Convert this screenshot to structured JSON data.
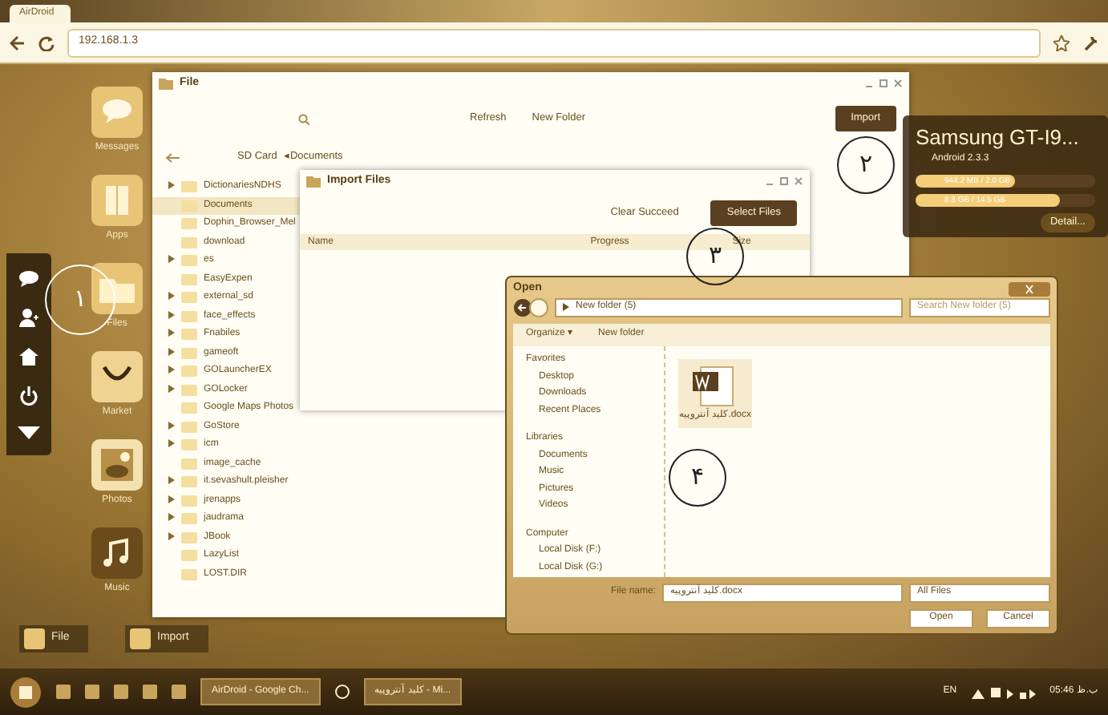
{
  "browser": {
    "tab_title": "AirDroid",
    "address": "192.168.1.3"
  },
  "desktop_icons": [
    {
      "label": "Messages",
      "kind": "messages"
    },
    {
      "label": "Apps",
      "kind": "apps"
    },
    {
      "label": "Files",
      "kind": "files"
    },
    {
      "label": "Market",
      "kind": "market"
    },
    {
      "label": "Photos",
      "kind": "photos"
    },
    {
      "label": "Music",
      "kind": "music"
    }
  ],
  "file_window": {
    "title": "File",
    "buttons": [
      "Refresh",
      "New Folder"
    ],
    "import_button": "Import",
    "breadcrumb": [
      "SD Card",
      "◂Documents"
    ],
    "tree": [
      {
        "label": "DictionariesNDHS",
        "expandable": true,
        "selected": false
      },
      {
        "label": "Documents",
        "expandable": false,
        "selected": true
      },
      {
        "label": "Dophin_Browser_Mel",
        "expandable": false,
        "selected": false
      },
      {
        "label": "download",
        "expandable": false,
        "selected": false
      },
      {
        "label": "es",
        "expandable": true,
        "selected": false
      },
      {
        "label": "EasyExpen",
        "expandable": false,
        "selected": false
      },
      {
        "label": "external_sd",
        "expandable": true,
        "selected": false
      },
      {
        "label": "face_effects",
        "expandable": true,
        "selected": false
      },
      {
        "label": "Fnabiles",
        "expandable": true,
        "selected": false
      },
      {
        "label": "gameoft",
        "expandable": true,
        "selected": false
      },
      {
        "label": "GOLauncherEX",
        "expandable": true,
        "selected": false
      },
      {
        "label": "GOLocker",
        "expandable": true,
        "selected": false
      },
      {
        "label": "Google Maps Photos",
        "expandable": false,
        "selected": false
      },
      {
        "label": "GoStore",
        "expandable": true,
        "selected": false
      },
      {
        "label": "icm",
        "expandable": true,
        "selected": false
      },
      {
        "label": "image_cache",
        "expandable": false,
        "selected": false
      },
      {
        "label": "it.sevashult.pleisher",
        "expandable": true,
        "selected": false
      },
      {
        "label": "jrenapps",
        "expandable": true,
        "selected": false
      },
      {
        "label": "jaudrama",
        "expandable": true,
        "selected": false
      },
      {
        "label": "JBook",
        "expandable": true,
        "selected": false
      },
      {
        "label": "LazyList",
        "expandable": false,
        "selected": false
      },
      {
        "label": "LOST.DIR",
        "expandable": false,
        "selected": false
      }
    ]
  },
  "import_window": {
    "title": "Import Files",
    "clear_button": "Clear Succeed",
    "select_button": "Select Files",
    "columns": [
      "Name",
      "Progress",
      "Size"
    ]
  },
  "device": {
    "name": "Samsung GT-I9...",
    "os": "Android 2.3.3",
    "storage": [
      {
        "reading": "944.2 MB / 2.0 GB",
        "level": 0.55
      },
      {
        "reading": "8.8 GB / 14.5 GB",
        "level": 0.8
      }
    ],
    "detail_button": "Detail..."
  },
  "open_dialog": {
    "title": "Open",
    "path": "New folder (5)",
    "search_placeholder": "Search New folder (5)",
    "organize": "Organize ▾",
    "new_folder": "New folder",
    "nav": [
      {
        "label": "Favorites",
        "kind": "group"
      },
      {
        "label": "Desktop",
        "kind": "item"
      },
      {
        "label": "Downloads",
        "kind": "item"
      },
      {
        "label": "Recent Places",
        "kind": "item"
      },
      {
        "label": "Libraries",
        "kind": "group"
      },
      {
        "label": "Documents",
        "kind": "item"
      },
      {
        "label": "Music",
        "kind": "item"
      },
      {
        "label": "Pictures",
        "kind": "item"
      },
      {
        "label": "Videos",
        "kind": "item"
      },
      {
        "label": "Computer",
        "kind": "group"
      },
      {
        "label": "Local Disk (F:)",
        "kind": "item"
      },
      {
        "label": "Local Disk (G:)",
        "kind": "item"
      }
    ],
    "file": "کلید آنتروپیه.docx",
    "file_name_label": "File name:",
    "file_name": "کلید آنتروپیه.docx",
    "filter": "All Files",
    "open_button": "Open",
    "cancel_button": "Cancel"
  },
  "annotations": [
    {
      "label": "۱",
      "kind": "light"
    },
    {
      "label": "۲",
      "kind": "dark"
    },
    {
      "label": "۳",
      "kind": "dark"
    },
    {
      "label": "۴",
      "kind": "dark"
    }
  ],
  "dock": [
    "File",
    "Import"
  ],
  "taskbar": {
    "windows": [
      "AirDroid - Google Ch...",
      "کلید آنتروپیه - Mi..."
    ],
    "language": "EN",
    "clock": "05:46 ب.ظ"
  }
}
